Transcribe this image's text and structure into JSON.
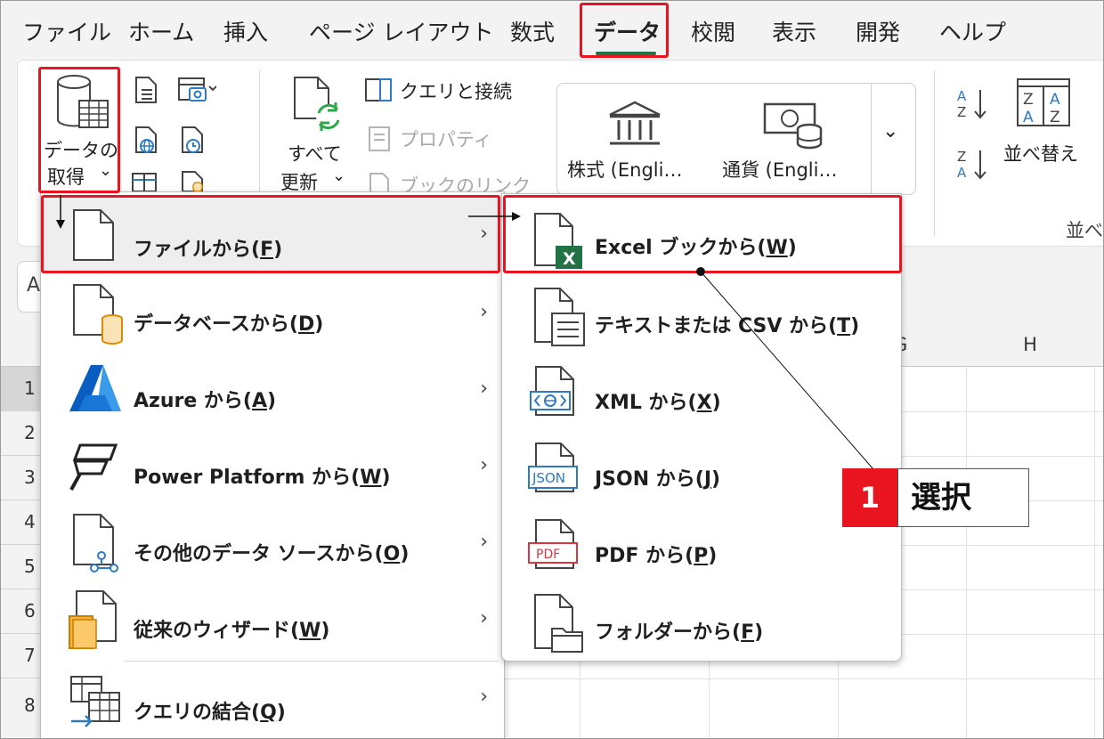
{
  "menubar": {
    "tabs": [
      "ファイル",
      "ホーム",
      "挿入",
      "ページ レイアウト",
      "数式",
      "データ",
      "校閲",
      "表示",
      "開発",
      "ヘルプ"
    ],
    "active_tab": "データ"
  },
  "ribbon": {
    "get_data_line1": "データの",
    "get_data_line2": "取得",
    "get_data_caret": "⌄",
    "refresh_line1": "すべて",
    "refresh_line2": "更新",
    "refresh_caret": "⌄",
    "queries_connections": "クエリと接続",
    "properties": "プロパティ",
    "book_links": "ブックのリンク",
    "stocks": "株式 (Engli…",
    "currency": "通貨 (Engli…",
    "gallery_more": "⌄",
    "sort": "並べ替え",
    "sort_group_partial": "並べ"
  },
  "sheet": {
    "namebox_partial": "A",
    "columns": [
      "G",
      "H"
    ],
    "rows": [
      "1",
      "2",
      "3",
      "4",
      "5",
      "6",
      "7",
      "8"
    ]
  },
  "menu_primary": {
    "items": [
      {
        "label": "ファイルから(",
        "key": "F",
        "close": ")",
        "arrow": "›"
      },
      {
        "label": "データベースから(",
        "key": "D",
        "close": ")",
        "arrow": "›"
      },
      {
        "label": "Azure から(",
        "key": "A",
        "close": ")",
        "arrow": "›"
      },
      {
        "label": "Power Platform から(",
        "key": "W",
        "close": ")",
        "arrow": "›"
      },
      {
        "label": "その他のデータ ソースから(",
        "key": "O",
        "close": ")",
        "arrow": "›"
      },
      {
        "label": "従来のウィザード(",
        "key": "W",
        "close": ")",
        "arrow": "›"
      },
      {
        "label": "クエリの結合(",
        "key": "Q",
        "close": ")",
        "arrow": "›"
      }
    ]
  },
  "menu_file": {
    "items": [
      {
        "label": "Excel ブックから(",
        "key": "W",
        "close": ")"
      },
      {
        "label": "テキストまたは CSV から(",
        "key": "T",
        "close": ")"
      },
      {
        "label": "XML から(",
        "key": "X",
        "close": ")"
      },
      {
        "label": "JSON から(",
        "key": "J",
        "close": ")"
      },
      {
        "label": "PDF から(",
        "key": "P",
        "close": ")"
      },
      {
        "label": "フォルダーから(",
        "key": "F",
        "close": ")"
      }
    ],
    "icon_badges": {
      "excel": "X",
      "json": "JSON",
      "pdf": "PDF"
    }
  },
  "annotation": {
    "step_number": "1",
    "step_text": "選択",
    "colors": {
      "highlight": "#e8141f",
      "excel_green": "#217346"
    }
  }
}
